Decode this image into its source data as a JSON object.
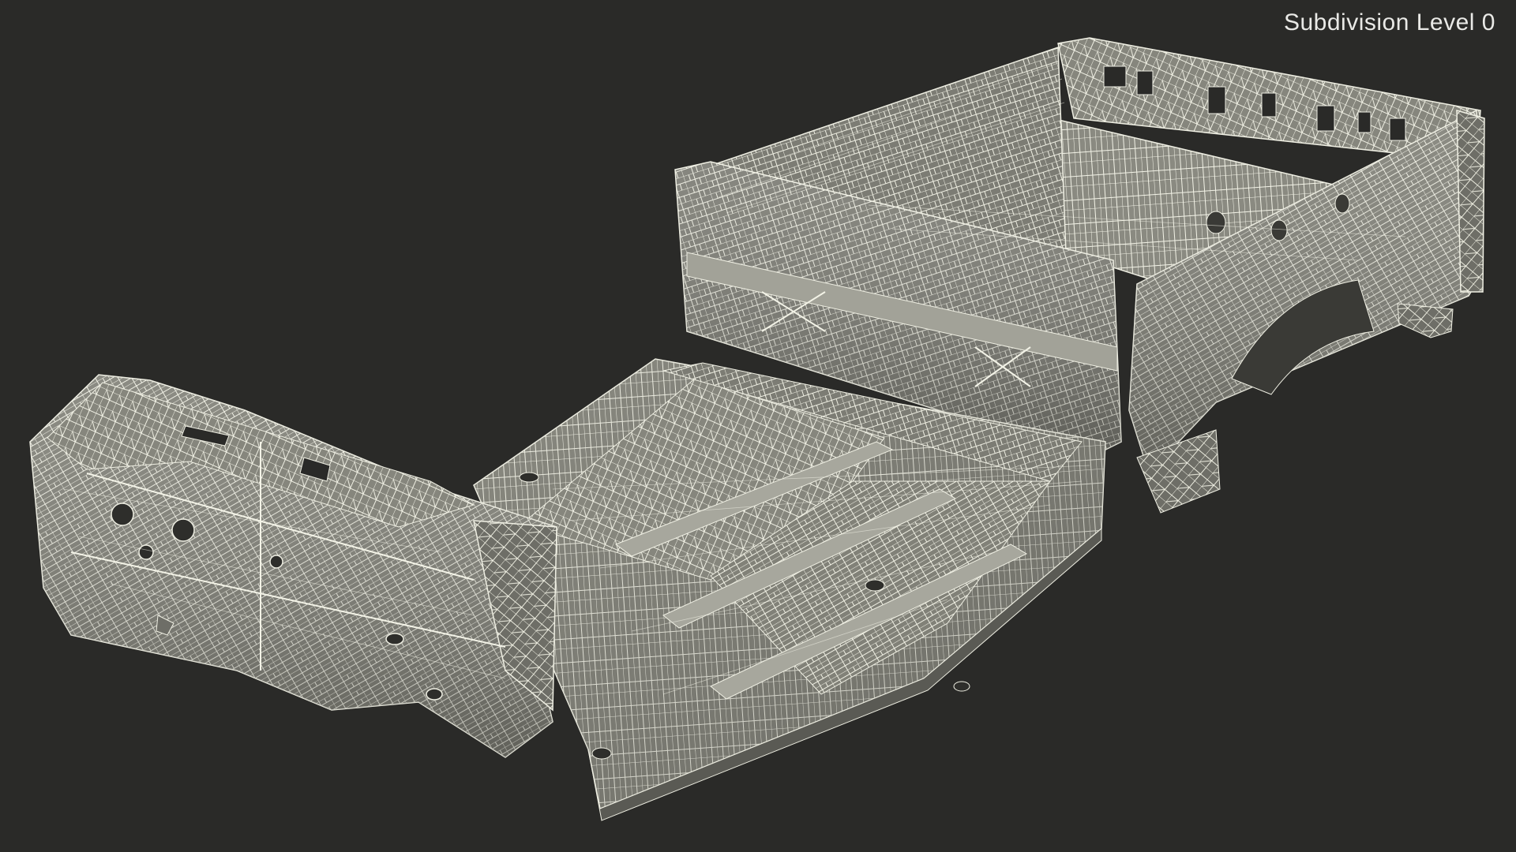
{
  "overlay": {
    "subdivision_label": "Subdivision Level 0"
  },
  "scene": {
    "subject": "pickup-truck-body-floor-and-bed-wireframe",
    "background_color": "#2a2a28",
    "surface_color": "#7a7a72",
    "surface_light_color": "#9a9a90",
    "surface_dark_color": "#55554f",
    "wire_color": "#f2f2e6"
  }
}
